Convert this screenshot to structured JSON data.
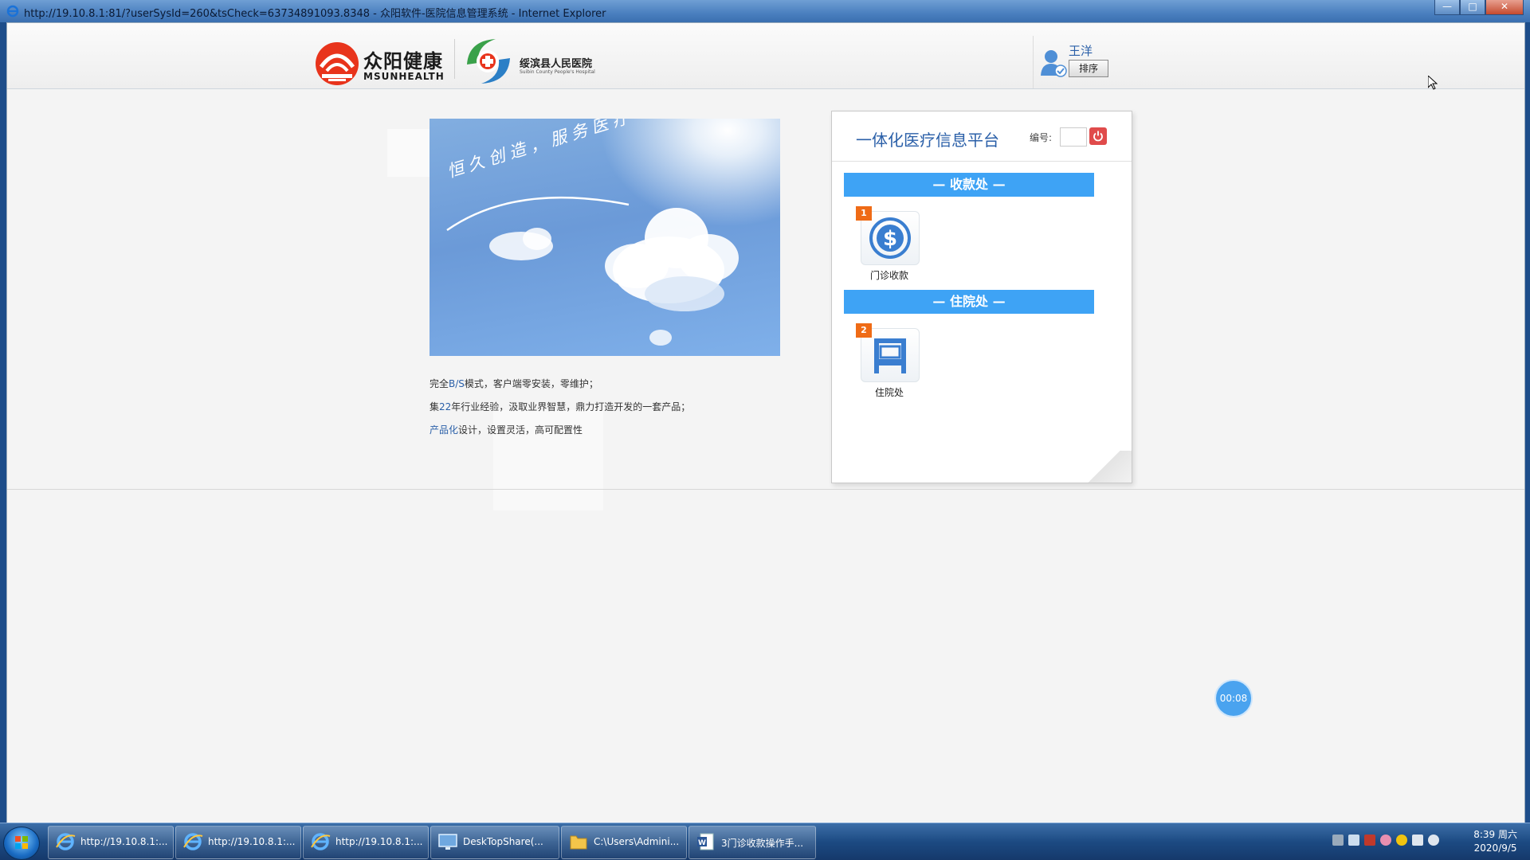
{
  "window": {
    "title": "http://19.10.8.1:81/?userSysId=260&tsCheck=63734891093.8348 - 众阳软件-医院信息管理系统 - Internet Explorer",
    "buttons": [
      "—",
      "□",
      "✕"
    ]
  },
  "header": {
    "brand_cn": "众阳健康",
    "brand_en": "MSUNHEALTH",
    "hospital_cn": "绥滨县人民医院",
    "hospital_en": "Suibin County People's Hospital",
    "user_name": "王洋",
    "sort_label": "排序"
  },
  "hero": {
    "slogan": "恒久创造，服务医疗"
  },
  "description": {
    "line1_a": "完全",
    "line1_hl": "B/S",
    "line1_b": "模式，客户端零安装，零维护；",
    "line2_a": "集",
    "line2_hl": "22",
    "line2_b": "年行业经验，汲取业界智慧，鼎力打造开发的一套产品；",
    "line3_hl": "产品化",
    "line3_b": "设计，设置灵活，高可配置性"
  },
  "panel": {
    "title": "一体化医疗信息平台",
    "code_label": "编号:",
    "code_value": "",
    "power_icon": "power-icon",
    "sections": [
      {
        "title": "— 收款处 —",
        "module": {
          "badge": "1",
          "label": "门诊收款",
          "icon": "dollar-icon"
        }
      },
      {
        "title": "— 住院处 —",
        "module": {
          "badge": "2",
          "label": "住院处",
          "icon": "bed-icon"
        }
      }
    ]
  },
  "timer": "00:08",
  "taskbar": {
    "items": [
      {
        "label": "http://19.10.8.1:...",
        "icon": "ie-icon"
      },
      {
        "label": "http://19.10.8.1:...",
        "icon": "ie-icon"
      },
      {
        "label": "http://19.10.8.1:...",
        "icon": "ie-icon"
      },
      {
        "label": "DeskTopShare(...",
        "icon": "monitor-icon"
      },
      {
        "label": "C:\\Users\\Admini...",
        "icon": "folder-icon"
      },
      {
        "label": "3门诊收款操作手...",
        "icon": "word-icon"
      }
    ],
    "clock_time": "8:39 周六",
    "clock_date": "2020/9/5"
  },
  "colors": {
    "accent_blue": "#3ea3f5",
    "title_blue": "#2a5fa8",
    "badge_orange": "#ef6b16",
    "power_red": "#e04b4b"
  }
}
